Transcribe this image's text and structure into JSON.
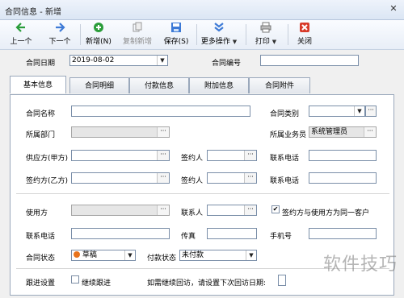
{
  "window": {
    "title": "合同信息 - 新增",
    "close": "✕"
  },
  "toolbar": {
    "prev": "上一个",
    "next": "下一个",
    "new": "新增(N)",
    "copy_new": "复制新增",
    "save": "保存(S)",
    "more": "更多操作",
    "print": "打印",
    "close": "关闭"
  },
  "header": {
    "contract_date_label": "合同日期",
    "contract_date_value": "2019-08-02",
    "contract_no_label": "合同编号",
    "contract_no_value": ""
  },
  "tabs": [
    "基本信息",
    "合同明细",
    "付款信息",
    "附加信息",
    "合同附件"
  ],
  "form": {
    "contract_name_label": "合同名称",
    "contract_name_value": "",
    "contract_type_label": "合同类别",
    "contract_type_value": "",
    "dept_label": "所属部门",
    "dept_value": "",
    "salesman_label": "所属业务员",
    "salesman_value": "系统管理员",
    "supplier_label": "供应方(甲方)",
    "supplier_value": "",
    "signer1_label": "签约人",
    "signer1_value": "",
    "phone1_label": "联系电话",
    "phone1_value": "",
    "party_b_label": "签约方(乙方)",
    "party_b_value": "",
    "signer2_label": "签约人",
    "signer2_value": "",
    "phone2_label": "联系电话",
    "phone2_value": "",
    "user_label": "使用方",
    "user_value": "",
    "contact_label": "联系人",
    "contact_value": "",
    "same_customer_label": "签约方与使用方为同一客户",
    "same_customer_checked": true,
    "contact_phone_label": "联系电话",
    "contact_phone_value": "",
    "fax_label": "传真",
    "fax_value": "",
    "mobile_label": "手机号",
    "mobile_value": "",
    "status_label": "合同状态",
    "status_value": "草稿",
    "pay_status_label": "付款状态",
    "pay_status_value": "未付款",
    "follow_label": "跟进设置",
    "continue_follow_label": "继续跟进",
    "continue_follow_checked": false,
    "follow_hint": "如需继续回访，请设置下次回访日期:"
  },
  "watermark": "软件技巧",
  "colors": {
    "status_dot": "#e8741e",
    "accent_green": "#2a9d3a",
    "accent_blue": "#3d7ad6",
    "close_red": "#d83b2a"
  }
}
